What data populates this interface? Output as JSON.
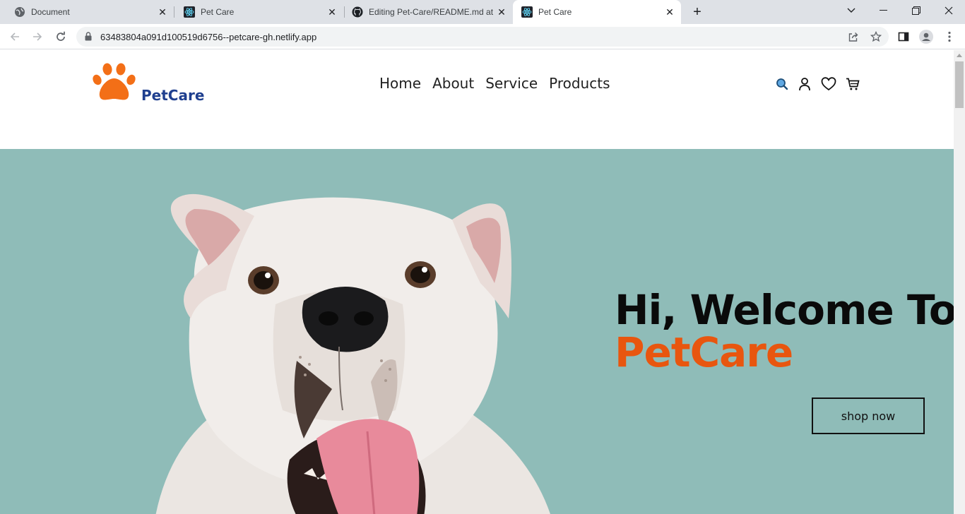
{
  "browser": {
    "tabs": [
      {
        "title": "Document",
        "icon": "globe-icon",
        "active": false
      },
      {
        "title": "Pet Care",
        "icon": "react-icon",
        "active": false
      },
      {
        "title": "Editing Pet-Care/README.md at",
        "icon": "github-icon",
        "active": false
      },
      {
        "title": "Pet Care",
        "icon": "react-icon",
        "active": true
      }
    ],
    "new_tab": "+",
    "address": "63483804a091d100519d6756--petcare-gh.netlify.app"
  },
  "site": {
    "brand": "PetCare",
    "nav": [
      "Home",
      "About",
      "Service",
      "Products"
    ],
    "header_icons": [
      "search-icon",
      "user-icon",
      "heart-icon",
      "cart-icon"
    ],
    "hero": {
      "title": "Hi, Welcome To",
      "brand": "PetCare",
      "button": "shop now"
    }
  },
  "colors": {
    "brand_orange": "#e8560f",
    "logo_orange": "#f36f17",
    "brand_blue": "#1f3f8f",
    "hero_bg": "#8fbcb8",
    "search_icon": "#2d88d6"
  }
}
